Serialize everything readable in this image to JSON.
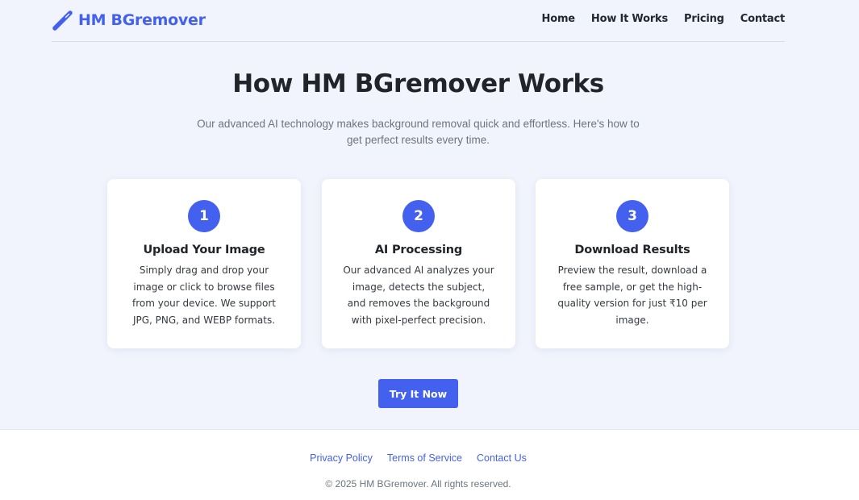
{
  "brand": {
    "name": "HM BGremover",
    "icon": "magic-wand-icon",
    "color": "#4361ee"
  },
  "nav": {
    "items": [
      {
        "label": "Home"
      },
      {
        "label": "How It Works"
      },
      {
        "label": "Pricing"
      },
      {
        "label": "Contact"
      }
    ]
  },
  "hero": {
    "title": "How HM BGremover Works",
    "subtitle": "Our advanced AI technology makes background removal quick and effortless. Here's how to get perfect results every time."
  },
  "steps": [
    {
      "number": "1",
      "title": "Upload Your Image",
      "description": "Simply drag and drop your image or click to browse files from your device. We support JPG, PNG, and WEBP formats."
    },
    {
      "number": "2",
      "title": "AI Processing",
      "description": "Our advanced AI analyzes your image, detects the subject, and removes the background with pixel-perfect precision."
    },
    {
      "number": "3",
      "title": "Download Results",
      "description": "Preview the result, download a free sample, or get the high-quality version for just ₹10 per image."
    }
  ],
  "cta": {
    "label": "Try It Now"
  },
  "footer": {
    "links": [
      {
        "label": "Privacy Policy"
      },
      {
        "label": "Terms of Service"
      },
      {
        "label": "Contact Us"
      }
    ],
    "copyright": "© 2025 HM BGremover. All rights reserved."
  },
  "colors": {
    "accent": "#4361ee",
    "page_background": "#f1f4fd",
    "card_background": "#ffffff",
    "heading_text": "#212529",
    "muted_text": "#6c757d"
  }
}
